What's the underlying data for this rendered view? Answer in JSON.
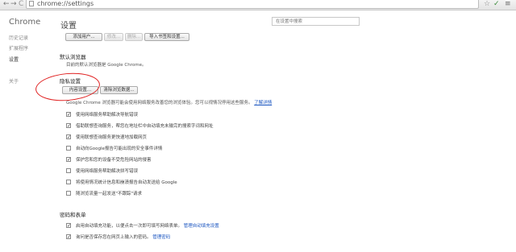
{
  "toolbar": {
    "back": "←",
    "forward": "→",
    "reload": "C",
    "url": "chrome://settings",
    "star": "☆",
    "shield": "✓",
    "menu": "≡"
  },
  "sidebar": {
    "title": "Chrome",
    "items": [
      {
        "label": "历史记录",
        "active": false
      },
      {
        "label": "扩展程序",
        "active": false
      },
      {
        "label": "设置",
        "active": true
      },
      {
        "label": "关于",
        "active": false
      }
    ]
  },
  "main": {
    "title": "设置",
    "search_placeholder": "在设置中搜索",
    "user_buttons": [
      "添加用户...",
      "修改...",
      "删除...",
      "导入书签和设置..."
    ],
    "default_browser": {
      "title": "默认浏览器",
      "desc": "目前的默认浏览器是 Google Chrome。"
    },
    "privacy": {
      "title": "隐私设置",
      "content_settings_button": "内容设置...",
      "clear_data_button": "清除浏览数据...",
      "desc": "Google Chrome 浏览器可能会使用网络服务改善您的浏览体验。您可以视情况停用这些服务。",
      "learn_more": "了解详情",
      "options": [
        {
          "label": "使用网络服务帮助解决导航错误",
          "checked": true
        },
        {
          "label": "借助联想查询服务，帮您在地址栏中自动填充未输完的搜索字词和网址",
          "checked": true
        },
        {
          "label": "使用联想查询服务更快速地加载网页",
          "checked": true
        },
        {
          "label": "自动向Google报告可能出现的安全事件详情",
          "checked": false
        },
        {
          "label": "保护您和您的设备不受危险网站的侵害",
          "checked": true
        },
        {
          "label": "使用网络服务帮助解决拼写错误",
          "checked": false
        },
        {
          "label": "将使用情况统计信息和崩溃报告自动发送给 Google",
          "checked": false
        },
        {
          "label": "随浏览流量一起发送\"不跟踪\"请求",
          "checked": false
        }
      ]
    },
    "passwords": {
      "title": "密码和表单",
      "options": [
        {
          "label": "启用自动填充功能，以便点击一次即可填写网络表单。",
          "link": "管理自动填充设置",
          "checked": true
        },
        {
          "label": "询问是否保存您在网页上输入的密码。",
          "link": "管理密码",
          "checked": true
        }
      ]
    }
  }
}
